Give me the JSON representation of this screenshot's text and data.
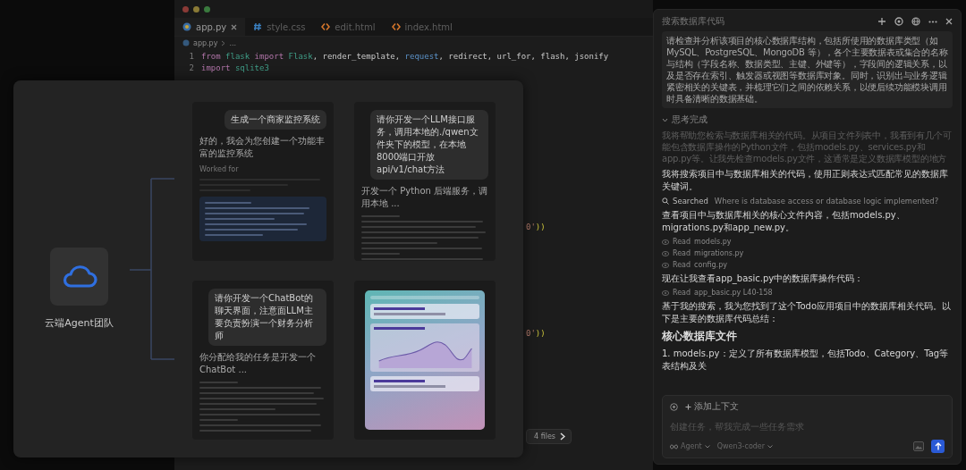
{
  "editor": {
    "window_controls": [
      {
        "color": "#8a3a36"
      },
      {
        "color": "#8a7a36"
      },
      {
        "color": "#3a7a3e"
      }
    ],
    "tabs": [
      {
        "label": "app.py",
        "kind": "python",
        "selected": true,
        "closable": true
      },
      {
        "label": "style.css",
        "kind": "css",
        "selected": false,
        "closable": false
      },
      {
        "label": "edit.html",
        "kind": "html",
        "selected": false,
        "closable": false
      },
      {
        "label": "index.html",
        "kind": "html",
        "selected": false,
        "closable": false
      }
    ],
    "breadcrumb": [
      "app.py",
      "..."
    ],
    "code": [
      {
        "kind": "line",
        "number": "1",
        "tokens": [
          {
            "text": "from ",
            "kind": "keyword"
          },
          {
            "text": "flask ",
            "kind": "module"
          },
          {
            "text": "import ",
            "kind": "keyword"
          },
          {
            "text": "Flask",
            "kind": "module"
          },
          {
            "text": ", render_template, ",
            "kind": "plain"
          },
          {
            "text": "request",
            "kind": "name"
          },
          {
            "text": ", redirect, url_for, flash, jsonify",
            "kind": "plain"
          }
        ]
      },
      {
        "kind": "line",
        "number": "2",
        "tokens": [
          {
            "text": "import ",
            "kind": "keyword"
          },
          {
            "text": "sqlite3",
            "kind": "module"
          }
        ]
      },
      {
        "kind": "fragment",
        "tokens": [
          {
            "text": "0'",
            "kind": "string"
          },
          {
            "text": "))",
            "kind": "paren"
          }
        ]
      },
      {
        "kind": "fragment",
        "tokens": [
          {
            "text": "0'",
            "kind": "string"
          },
          {
            "text": "))",
            "kind": "paren"
          }
        ]
      }
    ],
    "files_button": {
      "label": "4 files"
    }
  },
  "agent_team": {
    "name": "云端Agent团队",
    "cards": [
      {
        "kind": "chat",
        "request": "生成一个商家监控系统",
        "reply": "好的，我会为您创建一个功能丰富的监控系统",
        "note": "Worked for",
        "plan": true
      },
      {
        "kind": "chat",
        "request": "请你开发一个LLM接口服务，调用本地的./qwen文件夹下的模型，在本地8000端口开放api/v1/chat方法",
        "reply": "开发一个 Python 后端服务，调用本地 ...",
        "plan": false
      },
      {
        "kind": "chat",
        "request": "请你开发一个ChatBot的聊天界面，注意面LLM主要负责扮演一个财务分析师",
        "reply": "你分配给我的任务是开发一个 ChatBot ...",
        "plan": false
      },
      {
        "kind": "preview"
      }
    ]
  },
  "chat_panel": {
    "title": "搜索数据库代码",
    "prompt": "请检查并分析该项目的核心数据库结构，包括所使用的数据库类型（如 MySQL、PostgreSQL、MongoDB 等），各个主要数据表或集合的名称与结构（字段名称、数据类型、主键、外键等），字段间的逻辑关系，以及是否存在索引、触发器或视图等数据库对象。同时，识别出与业务逻辑紧密相关的关键表，并梳理它们之间的依赖关系，以便后续功能模块调用时具备清晰的数据基础。",
    "thought": {
      "label": "思考完成",
      "expanded": true,
      "text": "我将帮助您检索与数据库相关的代码。从项目文件列表中，我看到有几个可能包含数据库操作的Python文件，包括models.py、services.py和app.py等。让我先检查models.py文件，这通常是定义数据库模型的地方"
    },
    "messages": [
      {
        "kind": "text",
        "text": "我将搜索项目中与数据库相关的代码，使用正则表达式匹配常见的数据库关键词。"
      },
      {
        "kind": "search",
        "label": "Searched",
        "query": "Where is database access or database logic implemented?"
      },
      {
        "kind": "text",
        "text": "查看项目中与数据库相关的核心文件内容，包括models.py、migrations.py和app_new.py。"
      },
      {
        "kind": "read",
        "label": "Read",
        "file": "models.py"
      },
      {
        "kind": "read",
        "label": "Read",
        "file": "migrations.py"
      },
      {
        "kind": "read",
        "label": "Read",
        "file": "config.py"
      },
      {
        "kind": "text",
        "text": "现在让我查看app_basic.py中的数据库操作代码："
      },
      {
        "kind": "read",
        "label": "Read",
        "file": "app_basic.py L40-158"
      },
      {
        "kind": "text",
        "text": "基于我的搜索，我为您找到了这个Todo应用项目中的数据库相关代码。以下是主要的数据库代码总结："
      },
      {
        "kind": "heading",
        "text": "核心数据库文件"
      },
      {
        "kind": "text",
        "text": "1. models.py：定义了所有数据库模型，包括Todo、Category、Tag等表结构及关"
      }
    ],
    "input": {
      "context_chip": "添加上下文",
      "placeholder": "创建任务，帮我完成一些任务需求",
      "mode": "Agent",
      "model": "Qwen3-coder"
    }
  }
}
